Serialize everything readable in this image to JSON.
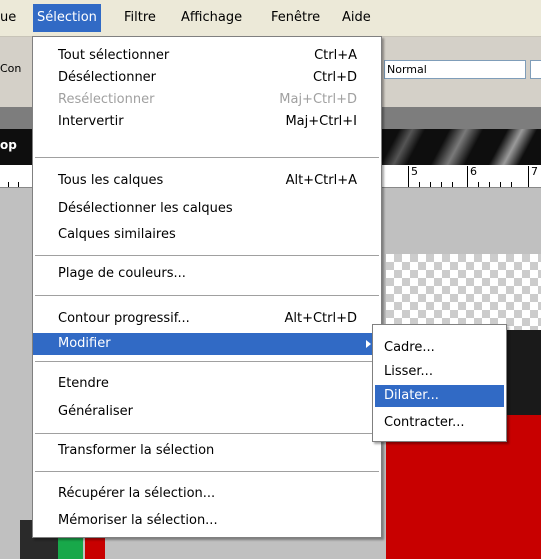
{
  "menubar": {
    "items": [
      {
        "label": "ue"
      },
      {
        "label": "Sélection",
        "active": true
      },
      {
        "label": "Filtre"
      },
      {
        "label": "Affichage"
      },
      {
        "label": "Fenêtre"
      },
      {
        "label": "Aide"
      }
    ]
  },
  "options_bar": {
    "left_cut_text": "Con",
    "mode_value": "Normal"
  },
  "document": {
    "title_cut": "op"
  },
  "ruler": {
    "numbers": [
      "5",
      "6",
      "7"
    ]
  },
  "selection_menu": {
    "items": [
      {
        "label": "Tout sélectionner",
        "shortcut": "Ctrl+A"
      },
      {
        "label": "Désélectionner",
        "shortcut": "Ctrl+D"
      },
      {
        "label": "Resélectionner",
        "shortcut": "Maj+Ctrl+D",
        "disabled": true
      },
      {
        "label": "Intervertir",
        "shortcut": "Maj+Ctrl+I"
      },
      {
        "label": "Tous les calques",
        "shortcut": "Alt+Ctrl+A"
      },
      {
        "label": "Désélectionner les calques",
        "shortcut": ""
      },
      {
        "label": "Calques similaires",
        "shortcut": ""
      },
      {
        "label": "Plage de couleurs...",
        "shortcut": ""
      },
      {
        "label": "Contour progressif...",
        "shortcut": "Alt+Ctrl+D"
      },
      {
        "label": "Modifier",
        "shortcut": "",
        "highlighted": true,
        "submenu": true
      },
      {
        "label": "Etendre",
        "shortcut": ""
      },
      {
        "label": "Généraliser",
        "shortcut": ""
      },
      {
        "label": "Transformer la sélection",
        "shortcut": ""
      },
      {
        "label": "Récupérer la sélection...",
        "shortcut": ""
      },
      {
        "label": "Mémoriser la sélection...",
        "shortcut": ""
      }
    ]
  },
  "modify_submenu": {
    "items": [
      {
        "label": "Cadre..."
      },
      {
        "label": "Lisser..."
      },
      {
        "label": "Dilater...",
        "highlighted": true
      },
      {
        "label": "Contracter..."
      }
    ]
  },
  "colors": {
    "highlight": "#316ac5",
    "menu_bg": "#ffffff",
    "disabled_text": "#a0a0a0"
  }
}
